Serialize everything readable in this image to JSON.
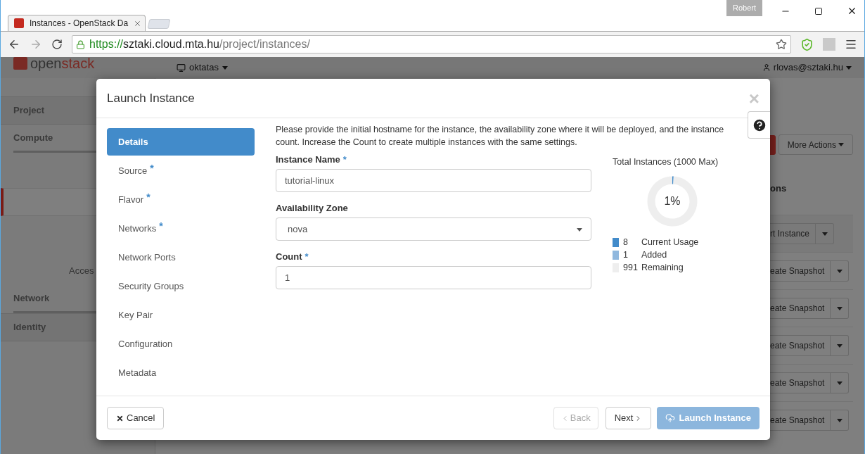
{
  "browser": {
    "tab_title": "Instances - OpenStack Da",
    "profile": "Robert",
    "url_scheme": "https://",
    "url_host": "sztaki.cloud.mta.hu",
    "url_path": "/project/instances/"
  },
  "header": {
    "logo_a": "open",
    "logo_b": "stack",
    "project": "oktatas",
    "user": "rlovas@sztaki.hu"
  },
  "sidebar": [
    {
      "label": "Project",
      "kind": "panel",
      "selected": false
    },
    {
      "label": "Compute",
      "kind": "group",
      "selected": false
    },
    {
      "kind": "item",
      "selected": true
    },
    {
      "label": "Acces",
      "kind": "sub",
      "selected": false
    },
    {
      "label": "Network",
      "kind": "group",
      "selected": false
    },
    {
      "label": "Identity",
      "kind": "panel",
      "selected": false
    }
  ],
  "page": {
    "more_actions": "More Actions",
    "column_heading": "ons",
    "row_actions": [
      "rt Instance",
      "eate Snapshot",
      "eate Snapshot",
      "eate Snapshot",
      "eate Snapshot",
      "eate Snapshot"
    ]
  },
  "modal": {
    "title": "Launch Instance",
    "close": "×",
    "steps": [
      {
        "label": "Details",
        "selected": true
      },
      {
        "label": "Source",
        "required_mark": "*",
        "selected": false
      },
      {
        "label": "Flavor",
        "required_mark": "*",
        "selected": false
      },
      {
        "label": "Networks",
        "required_mark": "*",
        "selected": false
      },
      {
        "label": "Network Ports",
        "selected": false
      },
      {
        "label": "Security Groups",
        "selected": false
      },
      {
        "label": "Key Pair",
        "selected": false
      },
      {
        "label": "Configuration",
        "selected": false
      },
      {
        "label": "Metadata",
        "selected": false
      }
    ],
    "intro": "Please provide the initial hostname for the instance, the availability zone where it will be deployed, and the instance count. Increase the Count to create multiple instances with the same settings.",
    "fields": [
      {
        "label": "Instance Name",
        "required_mark": "*",
        "kind": "text",
        "value": "tutorial-linux"
      },
      {
        "label": "Availability Zone",
        "kind": "select",
        "value": "nova"
      },
      {
        "label": "Count",
        "required_mark": "*",
        "kind": "text",
        "value": "1"
      }
    ],
    "quota": {
      "title": "Total Instances (1000 Max)",
      "center": "1%",
      "legend": [
        {
          "count": "8",
          "label": "Current Usage",
          "color": "#428bca"
        },
        {
          "count": "1",
          "label": "Added",
          "color": "#90b8de"
        },
        {
          "count": "991",
          "label": "Remaining",
          "color": "#eeeeee"
        }
      ]
    },
    "buttons": {
      "cancel": "Cancel",
      "back": "Back",
      "back_disabled": true,
      "next": "Next",
      "launch": "Launch Instance",
      "launch_disabled": true
    }
  }
}
